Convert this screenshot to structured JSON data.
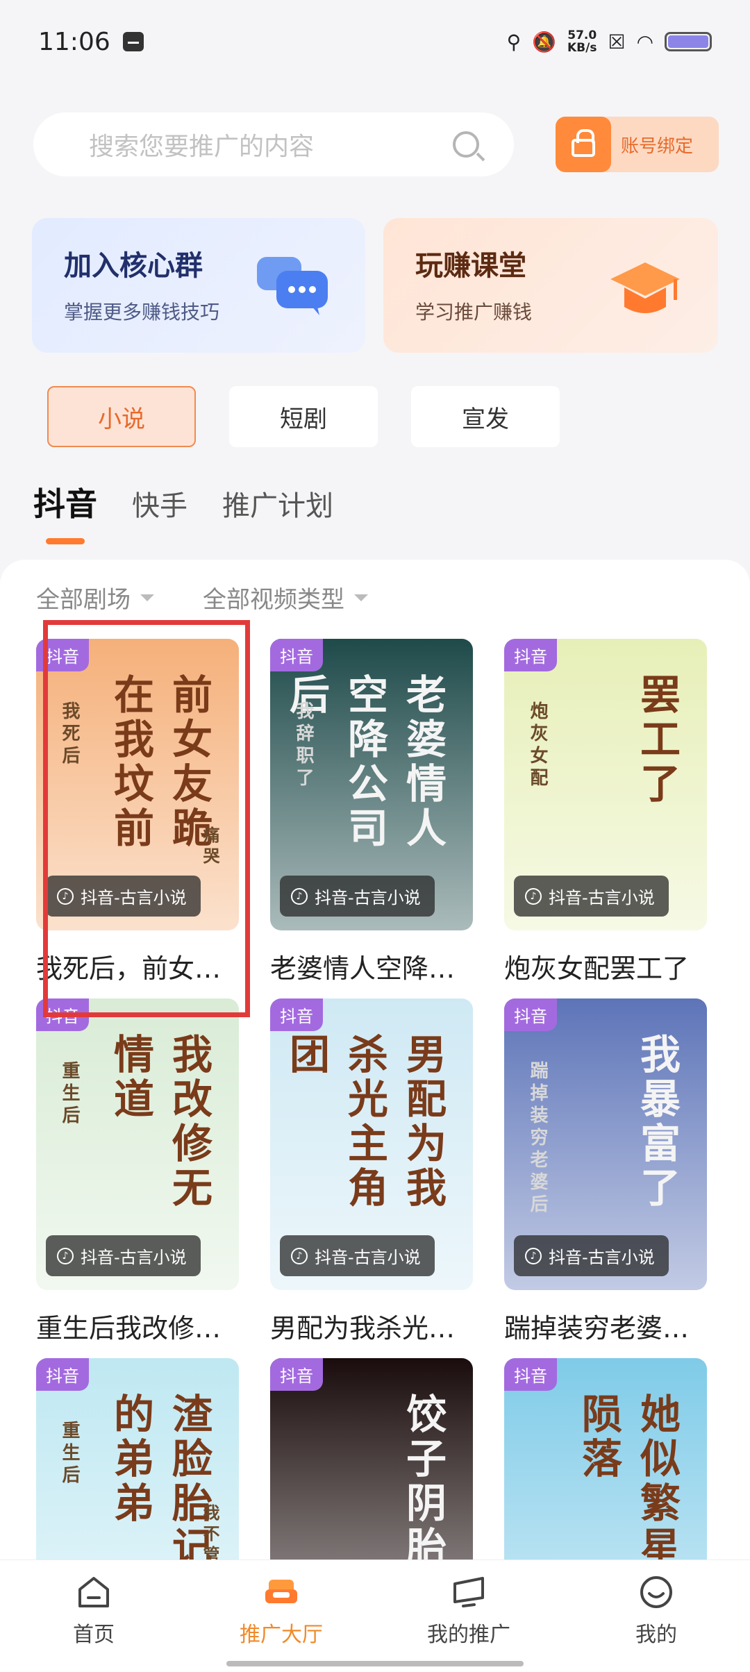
{
  "status_bar": {
    "time": "11:06",
    "speed_value": "57.0",
    "speed_unit": "KB/s"
  },
  "search": {
    "placeholder": "搜索您要推广的内容"
  },
  "bind_button": {
    "label": "账号绑定"
  },
  "cards": [
    {
      "title": "加入核心群",
      "subtitle": "掌握更多赚钱技巧",
      "icon": "chat-bubble-icon"
    },
    {
      "title": "玩赚课堂",
      "subtitle": "学习推广赚钱",
      "icon": "graduation-cap-icon"
    }
  ],
  "categories": [
    "小说",
    "短剧",
    "宣发"
  ],
  "active_category": "小说",
  "platform_tabs": [
    "抖音",
    "快手",
    "推广计划"
  ],
  "active_platform_tab": "抖音",
  "filters": [
    "全部剧场",
    "全部视频类型"
  ],
  "items": [
    {
      "platform_tag": "抖音",
      "genre_tag": "抖音-古言小说",
      "title": "我死后，前女…",
      "cover_text_main": "前女友跪在我坟前",
      "cover_text_side": "我死后",
      "cover_text_extra": "痛哭",
      "cover_bg": "#f5b07a"
    },
    {
      "platform_tag": "抖音",
      "genre_tag": "抖音-古言小说",
      "title": "老婆情人空降…",
      "cover_text_main": "老婆情人空降公司后",
      "cover_text_side": "我辞职了",
      "cover_text_extra": "",
      "cover_bg": "#1f4a4a"
    },
    {
      "platform_tag": "抖音",
      "genre_tag": "抖音-古言小说",
      "title": "炮灰女配罢工了",
      "cover_text_main": "罢工了",
      "cover_text_side": "炮灰女配",
      "cover_text_extra": "",
      "cover_bg": "#e7efb8"
    },
    {
      "platform_tag": "抖音",
      "genre_tag": "抖音-古言小说",
      "title": "重生后我改修…",
      "cover_text_main": "我改修无情道",
      "cover_text_side": "重生后",
      "cover_text_extra": "",
      "cover_bg": "#d9ecd6"
    },
    {
      "platform_tag": "抖音",
      "genre_tag": "抖音-古言小说",
      "title": "男配为我杀光…",
      "cover_text_main": "男配为我杀光主角团",
      "cover_text_side": "",
      "cover_text_extra": "",
      "cover_bg": "#cfe9f4"
    },
    {
      "platform_tag": "抖音",
      "genre_tag": "抖音-古言小说",
      "title": "踹掉装穷老婆…",
      "cover_text_main": "我暴富了",
      "cover_text_side": "踹掉装穷老婆后",
      "cover_text_extra": "",
      "cover_bg": "#5d74b8"
    },
    {
      "platform_tag": "抖音",
      "genre_tag": "",
      "title": "",
      "cover_text_main": "渣脸胎记的弟弟",
      "cover_text_side": "重生后",
      "cover_text_extra": "我不管了",
      "cover_bg": "#bfe8f2"
    },
    {
      "platform_tag": "抖音",
      "genre_tag": "",
      "title": "",
      "cover_text_main": "饺子阴胎",
      "cover_text_side": "",
      "cover_text_extra": "",
      "cover_bg": "#1a0c0c"
    },
    {
      "platform_tag": "抖音",
      "genre_tag": "",
      "title": "",
      "cover_text_main": "她似繁星陨落",
      "cover_text_side": "",
      "cover_text_extra": "",
      "cover_bg": "#7fcbe8"
    }
  ],
  "bottom_nav": [
    {
      "label": "首页",
      "icon": "home-icon"
    },
    {
      "label": "推广大厅",
      "icon": "sofa-icon"
    },
    {
      "label": "我的推广",
      "icon": "promotion-icon"
    },
    {
      "label": "我的",
      "icon": "smile-icon"
    }
  ],
  "active_nav": "推广大厅",
  "colors": {
    "accent": "#ff7a2f",
    "highlight": "#e23a3a",
    "platform_tag": "#a36ae0"
  }
}
